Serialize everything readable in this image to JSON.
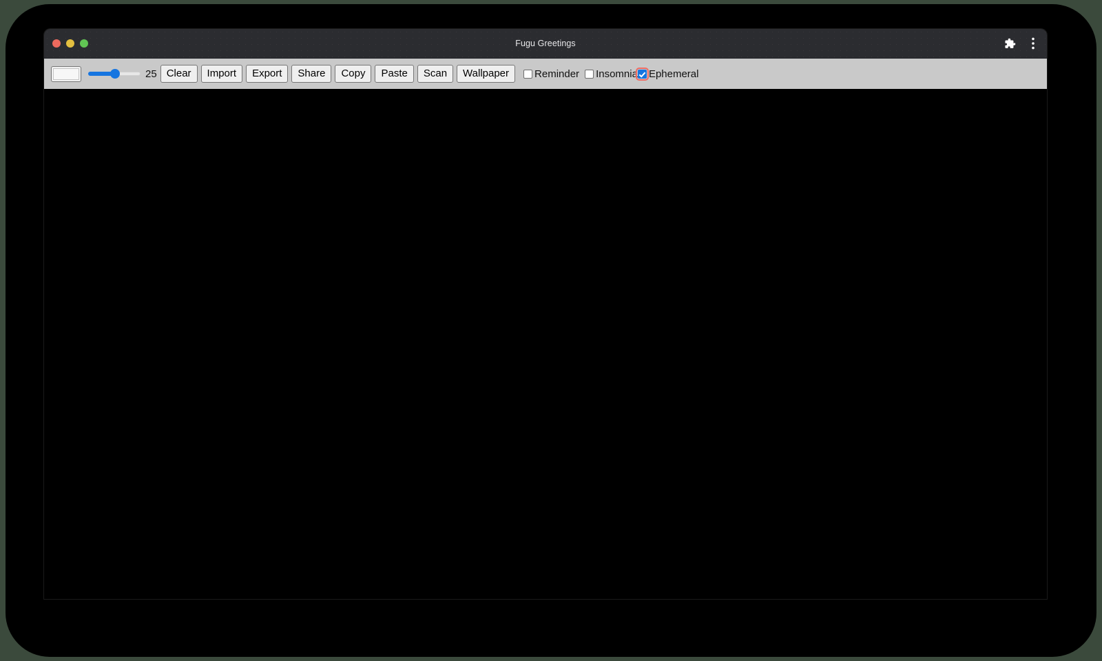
{
  "window": {
    "title": "Fugu Greetings",
    "traffic_lights": [
      {
        "name": "close",
        "color": "#ed6a5e"
      },
      {
        "name": "minimize",
        "color": "#e3bf40"
      },
      {
        "name": "maximize",
        "color": "#61c554"
      }
    ],
    "titlebar_icons": [
      {
        "name": "extensions-puzzle-icon"
      },
      {
        "name": "more-vertical-menu-icon"
      }
    ]
  },
  "toolbar": {
    "color_picker": {
      "name": "color-input",
      "value": "#f7f7f7"
    },
    "slider": {
      "name": "line-width-slider",
      "value": "25",
      "min": "1",
      "max": "50"
    },
    "slider_value_label": "25",
    "buttons": [
      {
        "label": "Clear"
      },
      {
        "label": "Import"
      },
      {
        "label": "Export"
      },
      {
        "label": "Share"
      },
      {
        "label": "Copy"
      },
      {
        "label": "Paste"
      },
      {
        "label": "Scan"
      },
      {
        "label": "Wallpaper"
      }
    ],
    "checkboxes": [
      {
        "label": "Reminder",
        "checked": false,
        "focused": false
      },
      {
        "label": "Insomnia",
        "checked": false,
        "focused": false
      },
      {
        "label": "Ephemeral",
        "checked": true,
        "focused": true
      }
    ]
  },
  "canvas": {
    "name": "drawing-canvas",
    "background": "#000000"
  },
  "colors": {
    "accent": "#1675e0",
    "focus_ring": "#ef6b63",
    "toolbar_bg": "#c9c9c9",
    "titlebar_bg": "#2b2c30",
    "desktop_bg": "#000000",
    "screen_bg": "#3b4a3c"
  }
}
